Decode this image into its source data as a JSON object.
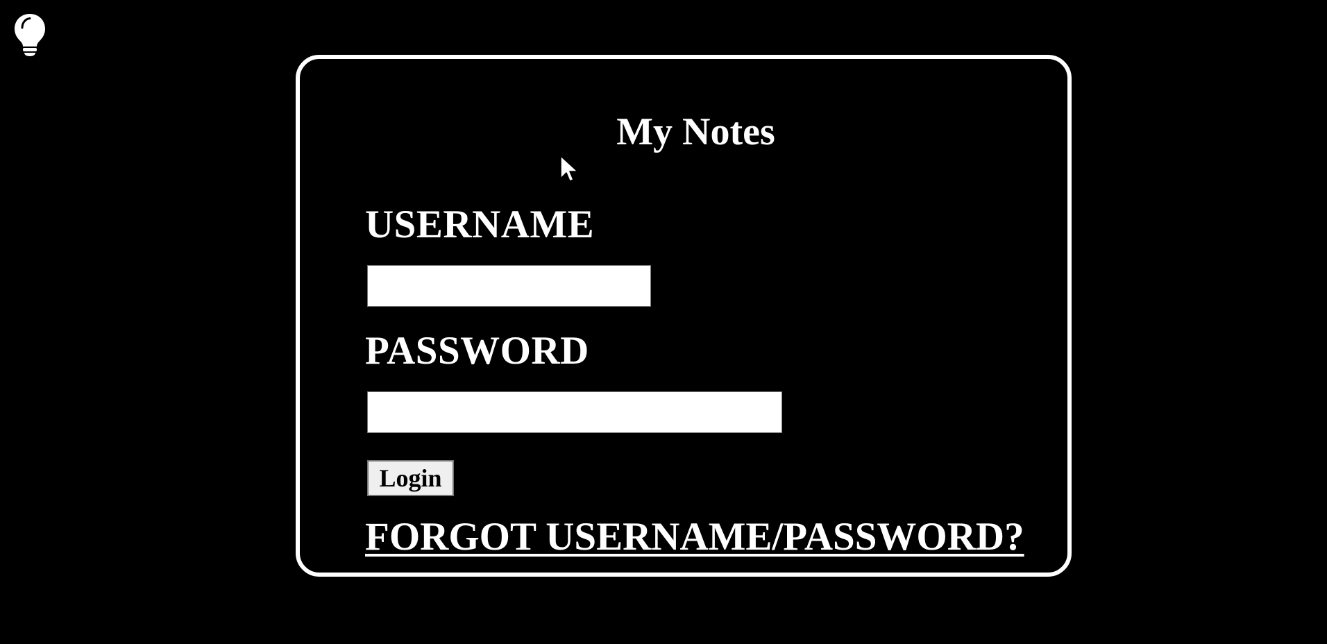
{
  "header": {
    "theme_toggle_icon": "lightbulb-icon"
  },
  "login_card": {
    "title": "My Notes",
    "username_label": "USERNAME",
    "username_value": "",
    "password_label": "PASSWORD",
    "password_value": "",
    "login_button_label": "Login",
    "forgot_link_label": "FORGOT USERNAME/PASSWORD?"
  },
  "colors": {
    "background": "#000000",
    "foreground": "#ffffff",
    "button_background": "#efefef"
  }
}
